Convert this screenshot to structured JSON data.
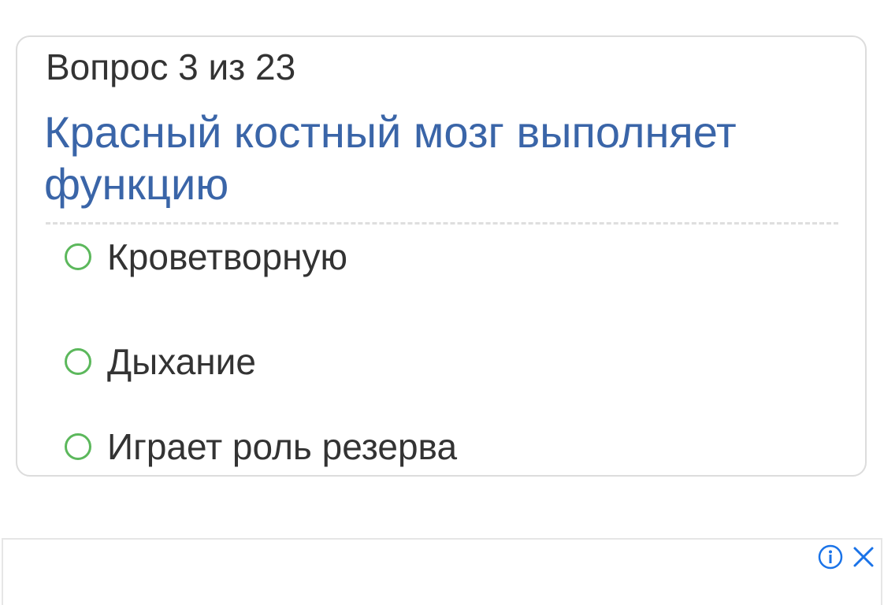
{
  "quiz": {
    "counter": "Вопрос 3 из 23",
    "question": "Красный костный мозг выполняет функцию",
    "options": [
      {
        "label": "Кроветворную"
      },
      {
        "label": "Дыхание"
      },
      {
        "label": "Играет роль резерва"
      }
    ]
  },
  "ad": {
    "icons": [
      "info-icon",
      "close-icon"
    ]
  },
  "colors": {
    "question_text": "#3a65a8",
    "radio_border": "#5cb85c",
    "body_text": "#333333",
    "ad_icon": "#1a73e8"
  }
}
